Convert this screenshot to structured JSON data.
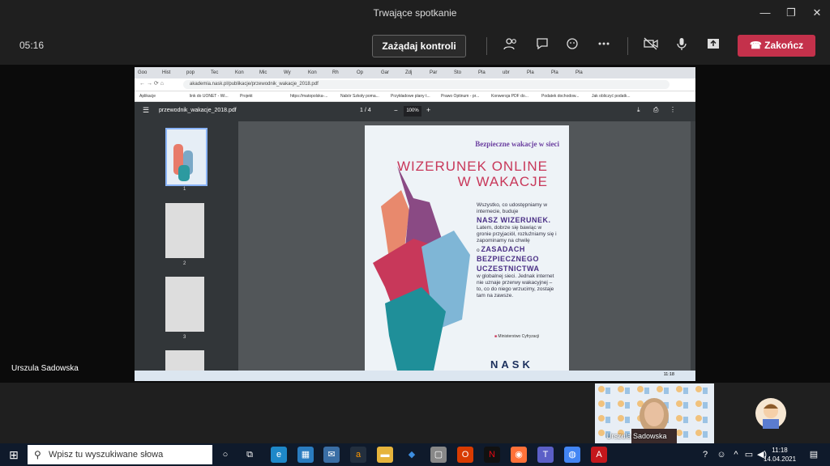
{
  "window": {
    "title": "Trwające spotkanie",
    "minimize": "—",
    "maximize": "❐",
    "close": "✕"
  },
  "meeting": {
    "timer": "05:16",
    "request_control": "Zażądaj kontroli",
    "end_call": "Zakończ"
  },
  "browser": {
    "tabs": [
      "Goo",
      "Hist",
      "pop",
      "Tec",
      "Kon",
      "Mic",
      "Wy",
      "Kon",
      "Rh",
      "Op",
      "Gar",
      "Zdj",
      "Par",
      "Sto",
      "Pla",
      "ubr",
      "Pla",
      "Pla",
      "Pla"
    ],
    "url": "akademia.nask.pl/publikacje/przewodnik_wakacje_2018.pdf",
    "bookmarks": [
      "Aplikacje",
      "link do UONET - Wi...",
      "Projekt",
      "https://matopolska-...",
      "Nabór Szkoły poma...",
      "Przykładowe plany t...",
      "Prawo Optinum - pr...",
      "Konwersja PDF do...",
      "Podatek dochodow...",
      "Jak obliczyć podatk..."
    ]
  },
  "pdf": {
    "filename": "przewodnik_wakacje_2018.pdf",
    "page_current": "1",
    "page_sep": "/",
    "page_total": "4",
    "zoom": "100%",
    "thumb_labels": [
      "1",
      "2",
      "3"
    ],
    "page1": {
      "subtitle": "Bezpieczne wakacje w sieci",
      "title_line1": "WIZERUNEK ONLINE",
      "title_line2": "W WAKACJE",
      "p1": "Wszystko, co udostępniamy w internecie, buduje",
      "p1_emph": "NASZ WIZERUNEK.",
      "p2": "Latem, dobrze się bawiąc w gronie przyjaciół, rozluźniamy się i zapominamy na chwilę",
      "p2_prefix": "o",
      "p2_emph": "ZASADACH BEZPIECZNEGO UCZESTNICTWA",
      "p3": "w globalnej sieci. Jednak internet nie uznaje przerwy wakacyjnej – to, co do niego wrzucimy, zostaje tam na zawsze.",
      "ministry": "Ministerstwo Cyfryzacji",
      "logo": "NASK"
    },
    "inner_clock": "11:18"
  },
  "participant_label": "Urszula Sadowska",
  "video_name": "Urszula Sadowska",
  "taskbar": {
    "search_placeholder": "Wpisz tu wyszukiwane słowa",
    "time": "11:18",
    "date": "14.04.2021"
  },
  "colors": {
    "end_red": "#c4314b",
    "title_pink": "#c8385a",
    "accent_purple": "#6b3fa0"
  }
}
